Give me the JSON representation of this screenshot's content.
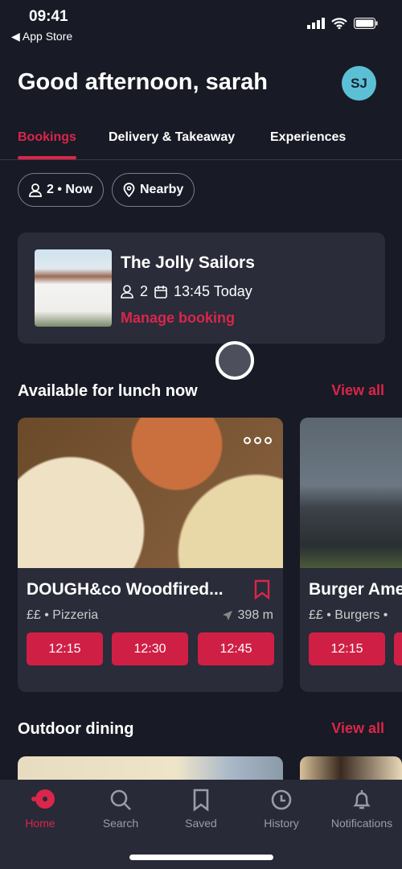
{
  "status_bar": {
    "time": "09:41",
    "back_label": "App Store"
  },
  "header": {
    "greeting": "Good afternoon, sarah",
    "avatar_initials": "SJ"
  },
  "tabs": [
    {
      "label": "Bookings",
      "active": true
    },
    {
      "label": "Delivery & Takeaway"
    },
    {
      "label": "Experiences"
    }
  ],
  "filters": {
    "party": "2 • Now",
    "location": "Nearby"
  },
  "booking": {
    "name": "The Jolly Sailors",
    "guests": "2",
    "time": "13:45 Today",
    "manage_label": "Manage booking"
  },
  "lunch_section": {
    "title": "Available for lunch now",
    "view_all": "View all",
    "restaurants": [
      {
        "name": "DOUGH&co Woodfired...",
        "meta": "££ • Pizzeria",
        "distance": "398 m",
        "slots": [
          "12:15",
          "12:30",
          "12:45"
        ]
      },
      {
        "name": "Burger Ame",
        "meta": "££ • Burgers •",
        "slots": [
          "12:15"
        ]
      }
    ]
  },
  "outdoor_section": {
    "title": "Outdoor dining",
    "view_all": "View all"
  },
  "nav": [
    {
      "label": "Home",
      "active": true
    },
    {
      "label": "Search"
    },
    {
      "label": "Saved"
    },
    {
      "label": "History"
    },
    {
      "label": "Notifications"
    }
  ],
  "colors": {
    "accent": "#d9264a",
    "background": "#181a25",
    "card": "#2a2c39",
    "avatar": "#5bc0d6"
  }
}
